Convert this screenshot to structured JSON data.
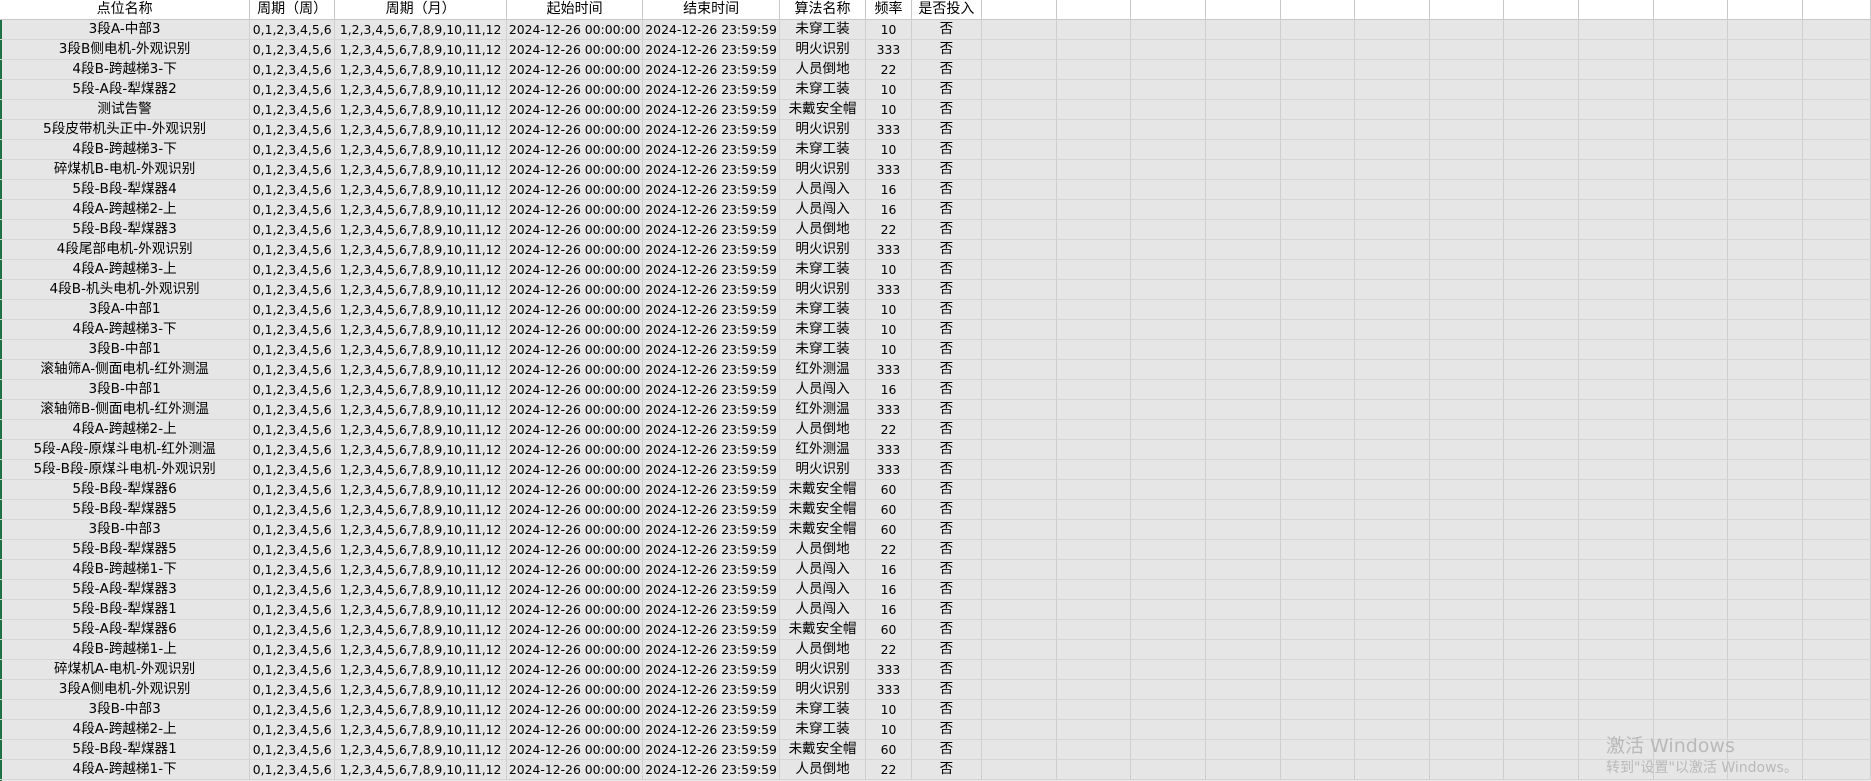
{
  "columns": {
    "name": "点位名称",
    "week": "周期（周）",
    "month": "周期（月）",
    "start": "起始时间",
    "end": "结束时间",
    "algo": "算法名称",
    "freq": "频率",
    "deployed": "是否投入"
  },
  "rows": [
    {
      "name": "3段A-中部3",
      "week": "0,1,2,3,4,5,6",
      "month": "1,2,3,4,5,6,7,8,9,10,11,12",
      "start": "2024-12-26 00:00:00",
      "end": "2024-12-26 23:59:59",
      "algo": "未穿工装",
      "freq": "10",
      "deployed": "否"
    },
    {
      "name": "3段B侧电机-外观识别",
      "week": "0,1,2,3,4,5,6",
      "month": "1,2,3,4,5,6,7,8,9,10,11,12",
      "start": "2024-12-26 00:00:00",
      "end": "2024-12-26 23:59:59",
      "algo": "明火识别",
      "freq": "333",
      "deployed": "否"
    },
    {
      "name": "4段B-跨越梯3-下",
      "week": "0,1,2,3,4,5,6",
      "month": "1,2,3,4,5,6,7,8,9,10,11,12",
      "start": "2024-12-26 00:00:00",
      "end": "2024-12-26 23:59:59",
      "algo": "人员倒地",
      "freq": "22",
      "deployed": "否"
    },
    {
      "name": "5段-A段-犁煤器2",
      "week": "0,1,2,3,4,5,6",
      "month": "1,2,3,4,5,6,7,8,9,10,11,12",
      "start": "2024-12-26 00:00:00",
      "end": "2024-12-26 23:59:59",
      "algo": "未穿工装",
      "freq": "10",
      "deployed": "否"
    },
    {
      "name": "测试告警",
      "week": "0,1,2,3,4,5,6",
      "month": "1,2,3,4,5,6,7,8,9,10,11,12",
      "start": "2024-12-26 00:00:00",
      "end": "2024-12-26 23:59:59",
      "algo": "未戴安全帽",
      "freq": "10",
      "deployed": "否"
    },
    {
      "name": "5段皮带机头正中-外观识别",
      "week": "0,1,2,3,4,5,6",
      "month": "1,2,3,4,5,6,7,8,9,10,11,12",
      "start": "2024-12-26 00:00:00",
      "end": "2024-12-26 23:59:59",
      "algo": "明火识别",
      "freq": "333",
      "deployed": "否"
    },
    {
      "name": "4段B-跨越梯3-下",
      "week": "0,1,2,3,4,5,6",
      "month": "1,2,3,4,5,6,7,8,9,10,11,12",
      "start": "2024-12-26 00:00:00",
      "end": "2024-12-26 23:59:59",
      "algo": "未穿工装",
      "freq": "10",
      "deployed": "否"
    },
    {
      "name": "碎煤机B-电机-外观识别",
      "week": "0,1,2,3,4,5,6",
      "month": "1,2,3,4,5,6,7,8,9,10,11,12",
      "start": "2024-12-26 00:00:00",
      "end": "2024-12-26 23:59:59",
      "algo": "明火识别",
      "freq": "333",
      "deployed": "否"
    },
    {
      "name": "5段-B段-犁煤器4",
      "week": "0,1,2,3,4,5,6",
      "month": "1,2,3,4,5,6,7,8,9,10,11,12",
      "start": "2024-12-26 00:00:00",
      "end": "2024-12-26 23:59:59",
      "algo": "人员闯入",
      "freq": "16",
      "deployed": "否"
    },
    {
      "name": "4段A-跨越梯2-上",
      "week": "0,1,2,3,4,5,6",
      "month": "1,2,3,4,5,6,7,8,9,10,11,12",
      "start": "2024-12-26 00:00:00",
      "end": "2024-12-26 23:59:59",
      "algo": "人员闯入",
      "freq": "16",
      "deployed": "否"
    },
    {
      "name": "5段-B段-犁煤器3",
      "week": "0,1,2,3,4,5,6",
      "month": "1,2,3,4,5,6,7,8,9,10,11,12",
      "start": "2024-12-26 00:00:00",
      "end": "2024-12-26 23:59:59",
      "algo": "人员倒地",
      "freq": "22",
      "deployed": "否"
    },
    {
      "name": "4段尾部电机-外观识别",
      "week": "0,1,2,3,4,5,6",
      "month": "1,2,3,4,5,6,7,8,9,10,11,12",
      "start": "2024-12-26 00:00:00",
      "end": "2024-12-26 23:59:59",
      "algo": "明火识别",
      "freq": "333",
      "deployed": "否"
    },
    {
      "name": "4段A-跨越梯3-上",
      "week": "0,1,2,3,4,5,6",
      "month": "1,2,3,4,5,6,7,8,9,10,11,12",
      "start": "2024-12-26 00:00:00",
      "end": "2024-12-26 23:59:59",
      "algo": "未穿工装",
      "freq": "10",
      "deployed": "否"
    },
    {
      "name": "4段B-机头电机-外观识别",
      "week": "0,1,2,3,4,5,6",
      "month": "1,2,3,4,5,6,7,8,9,10,11,12",
      "start": "2024-12-26 00:00:00",
      "end": "2024-12-26 23:59:59",
      "algo": "明火识别",
      "freq": "333",
      "deployed": "否"
    },
    {
      "name": "3段A-中部1",
      "week": "0,1,2,3,4,5,6",
      "month": "1,2,3,4,5,6,7,8,9,10,11,12",
      "start": "2024-12-26 00:00:00",
      "end": "2024-12-26 23:59:59",
      "algo": "未穿工装",
      "freq": "10",
      "deployed": "否"
    },
    {
      "name": "4段A-跨越梯3-下",
      "week": "0,1,2,3,4,5,6",
      "month": "1,2,3,4,5,6,7,8,9,10,11,12",
      "start": "2024-12-26 00:00:00",
      "end": "2024-12-26 23:59:59",
      "algo": "未穿工装",
      "freq": "10",
      "deployed": "否"
    },
    {
      "name": "3段B-中部1",
      "week": "0,1,2,3,4,5,6",
      "month": "1,2,3,4,5,6,7,8,9,10,11,12",
      "start": "2024-12-26 00:00:00",
      "end": "2024-12-26 23:59:59",
      "algo": "未穿工装",
      "freq": "10",
      "deployed": "否"
    },
    {
      "name": "滚轴筛A-侧面电机-红外测温",
      "week": "0,1,2,3,4,5,6",
      "month": "1,2,3,4,5,6,7,8,9,10,11,12",
      "start": "2024-12-26 00:00:00",
      "end": "2024-12-26 23:59:59",
      "algo": "红外测温",
      "freq": "333",
      "deployed": "否"
    },
    {
      "name": "3段B-中部1",
      "week": "0,1,2,3,4,5,6",
      "month": "1,2,3,4,5,6,7,8,9,10,11,12",
      "start": "2024-12-26 00:00:00",
      "end": "2024-12-26 23:59:59",
      "algo": "人员闯入",
      "freq": "16",
      "deployed": "否"
    },
    {
      "name": "滚轴筛B-侧面电机-红外测温",
      "week": "0,1,2,3,4,5,6",
      "month": "1,2,3,4,5,6,7,8,9,10,11,12",
      "start": "2024-12-26 00:00:00",
      "end": "2024-12-26 23:59:59",
      "algo": "红外测温",
      "freq": "333",
      "deployed": "否"
    },
    {
      "name": "4段A-跨越梯2-上",
      "week": "0,1,2,3,4,5,6",
      "month": "1,2,3,4,5,6,7,8,9,10,11,12",
      "start": "2024-12-26 00:00:00",
      "end": "2024-12-26 23:59:59",
      "algo": "人员倒地",
      "freq": "22",
      "deployed": "否"
    },
    {
      "name": "5段-A段-原煤斗电机-红外测温",
      "week": "0,1,2,3,4,5,6",
      "month": "1,2,3,4,5,6,7,8,9,10,11,12",
      "start": "2024-12-26 00:00:00",
      "end": "2024-12-26 23:59:59",
      "algo": "红外测温",
      "freq": "333",
      "deployed": "否"
    },
    {
      "name": "5段-B段-原煤斗电机-外观识别",
      "week": "0,1,2,3,4,5,6",
      "month": "1,2,3,4,5,6,7,8,9,10,11,12",
      "start": "2024-12-26 00:00:00",
      "end": "2024-12-26 23:59:59",
      "algo": "明火识别",
      "freq": "333",
      "deployed": "否"
    },
    {
      "name": "5段-B段-犁煤器6",
      "week": "0,1,2,3,4,5,6",
      "month": "1,2,3,4,5,6,7,8,9,10,11,12",
      "start": "2024-12-26 00:00:00",
      "end": "2024-12-26 23:59:59",
      "algo": "未戴安全帽",
      "freq": "60",
      "deployed": "否"
    },
    {
      "name": "5段-B段-犁煤器5",
      "week": "0,1,2,3,4,5,6",
      "month": "1,2,3,4,5,6,7,8,9,10,11,12",
      "start": "2024-12-26 00:00:00",
      "end": "2024-12-26 23:59:59",
      "algo": "未戴安全帽",
      "freq": "60",
      "deployed": "否"
    },
    {
      "name": "3段B-中部3",
      "week": "0,1,2,3,4,5,6",
      "month": "1,2,3,4,5,6,7,8,9,10,11,12",
      "start": "2024-12-26 00:00:00",
      "end": "2024-12-26 23:59:59",
      "algo": "未戴安全帽",
      "freq": "60",
      "deployed": "否"
    },
    {
      "name": "5段-B段-犁煤器5",
      "week": "0,1,2,3,4,5,6",
      "month": "1,2,3,4,5,6,7,8,9,10,11,12",
      "start": "2024-12-26 00:00:00",
      "end": "2024-12-26 23:59:59",
      "algo": "人员倒地",
      "freq": "22",
      "deployed": "否"
    },
    {
      "name": "4段B-跨越梯1-下",
      "week": "0,1,2,3,4,5,6",
      "month": "1,2,3,4,5,6,7,8,9,10,11,12",
      "start": "2024-12-26 00:00:00",
      "end": "2024-12-26 23:59:59",
      "algo": "人员闯入",
      "freq": "16",
      "deployed": "否"
    },
    {
      "name": "5段-A段-犁煤器3",
      "week": "0,1,2,3,4,5,6",
      "month": "1,2,3,4,5,6,7,8,9,10,11,12",
      "start": "2024-12-26 00:00:00",
      "end": "2024-12-26 23:59:59",
      "algo": "人员闯入",
      "freq": "16",
      "deployed": "否"
    },
    {
      "name": "5段-B段-犁煤器1",
      "week": "0,1,2,3,4,5,6",
      "month": "1,2,3,4,5,6,7,8,9,10,11,12",
      "start": "2024-12-26 00:00:00",
      "end": "2024-12-26 23:59:59",
      "algo": "人员闯入",
      "freq": "16",
      "deployed": "否"
    },
    {
      "name": "5段-A段-犁煤器6",
      "week": "0,1,2,3,4,5,6",
      "month": "1,2,3,4,5,6,7,8,9,10,11,12",
      "start": "2024-12-26 00:00:00",
      "end": "2024-12-26 23:59:59",
      "algo": "未戴安全帽",
      "freq": "60",
      "deployed": "否"
    },
    {
      "name": "4段B-跨越梯1-上",
      "week": "0,1,2,3,4,5,6",
      "month": "1,2,3,4,5,6,7,8,9,10,11,12",
      "start": "2024-12-26 00:00:00",
      "end": "2024-12-26 23:59:59",
      "algo": "人员倒地",
      "freq": "22",
      "deployed": "否"
    },
    {
      "name": "碎煤机A-电机-外观识别",
      "week": "0,1,2,3,4,5,6",
      "month": "1,2,3,4,5,6,7,8,9,10,11,12",
      "start": "2024-12-26 00:00:00",
      "end": "2024-12-26 23:59:59",
      "algo": "明火识别",
      "freq": "333",
      "deployed": "否"
    },
    {
      "name": "3段A侧电机-外观识别",
      "week": "0,1,2,3,4,5,6",
      "month": "1,2,3,4,5,6,7,8,9,10,11,12",
      "start": "2024-12-26 00:00:00",
      "end": "2024-12-26 23:59:59",
      "algo": "明火识别",
      "freq": "333",
      "deployed": "否"
    },
    {
      "name": "3段B-中部3",
      "week": "0,1,2,3,4,5,6",
      "month": "1,2,3,4,5,6,7,8,9,10,11,12",
      "start": "2024-12-26 00:00:00",
      "end": "2024-12-26 23:59:59",
      "algo": "未穿工装",
      "freq": "10",
      "deployed": "否"
    },
    {
      "name": "4段A-跨越梯2-上",
      "week": "0,1,2,3,4,5,6",
      "month": "1,2,3,4,5,6,7,8,9,10,11,12",
      "start": "2024-12-26 00:00:00",
      "end": "2024-12-26 23:59:59",
      "algo": "未穿工装",
      "freq": "10",
      "deployed": "否"
    },
    {
      "name": "5段-B段-犁煤器1",
      "week": "0,1,2,3,4,5,6",
      "month": "1,2,3,4,5,6,7,8,9,10,11,12",
      "start": "2024-12-26 00:00:00",
      "end": "2024-12-26 23:59:59",
      "algo": "未戴安全帽",
      "freq": "60",
      "deployed": "否"
    },
    {
      "name": "4段A-跨越梯1-下",
      "week": "0,1,2,3,4,5,6",
      "month": "1,2,3,4,5,6,7,8,9,10,11,12",
      "start": "2024-12-26 00:00:00",
      "end": "2024-12-26 23:59:59",
      "algo": "人员倒地",
      "freq": "22",
      "deployed": "否"
    }
  ],
  "watermark": {
    "line1": "激活 Windows",
    "line2": "转到\"设置\"以激活 Windows。"
  }
}
